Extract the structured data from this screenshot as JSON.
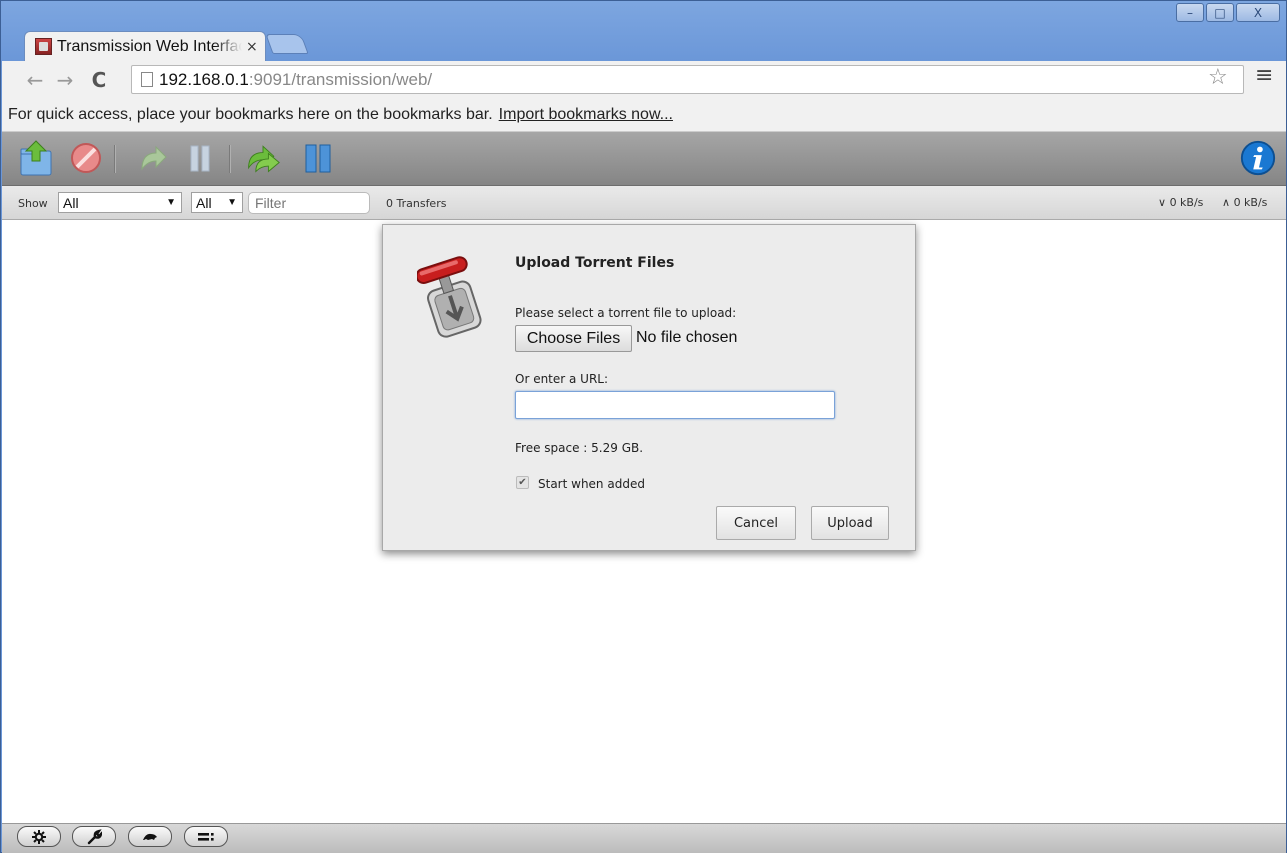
{
  "browser": {
    "tab_title": "Transmission Web Interface",
    "tab_close": "×",
    "url_host": "192.168.0.1",
    "url_rest": ":9091/transmission/web/",
    "window_controls": {
      "minimize": "–",
      "maximize": "□",
      "close": "X"
    },
    "nav": {
      "back": "←",
      "forward": "→",
      "reload": "C"
    },
    "star_icon": "☆",
    "menu_icon": "≡",
    "bookmarks_text": "For quick access, place your bookmarks here on the bookmarks bar.",
    "bookmarks_link": "Import bookmarks now..."
  },
  "filterbar": {
    "show_label": "Show",
    "state_filter": "All",
    "tracker_filter": "All",
    "filter_placeholder": "Filter",
    "transfers_count": "0 Transfers",
    "download_speed": "0 kB/s",
    "upload_speed": "0 kB/s"
  },
  "dialog": {
    "title": "Upload Torrent Files",
    "select_label": "Please select a torrent file to upload:",
    "choose_button": "Choose Files",
    "no_file": "No file chosen",
    "url_label": "Or enter a URL:",
    "url_value": "",
    "free_space": "Free space : 5.29 GB.",
    "start_when_added_label": "Start when added",
    "start_when_added_checked": true,
    "cancel_button": "Cancel",
    "upload_button": "Upload"
  },
  "colors": {
    "toolbar_gray": "#959595",
    "accent_blue": "#1a78d2",
    "green_icon": "#5aa628"
  }
}
